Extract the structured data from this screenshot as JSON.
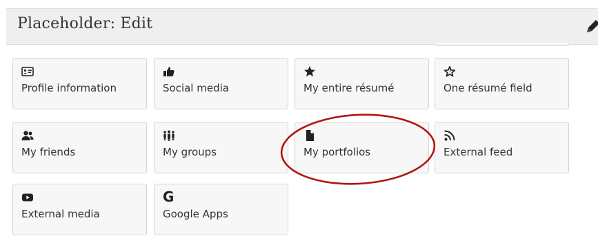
{
  "header": {
    "title": "Placeholder: Edit"
  },
  "tiles": [
    {
      "label": "Profile information",
      "icon": "id-card-icon"
    },
    {
      "label": "Social media",
      "icon": "thumbs-up-icon"
    },
    {
      "label": "My entire résumé",
      "icon": "star-icon"
    },
    {
      "label": "One résumé field",
      "icon": "star-outline-icon"
    },
    {
      "label": "My friends",
      "icon": "users-icon"
    },
    {
      "label": "My groups",
      "icon": "group-icon"
    },
    {
      "label": "My portfolios",
      "icon": "file-icon"
    },
    {
      "label": "External feed",
      "icon": "rss-icon"
    },
    {
      "label": "External media",
      "icon": "youtube-icon"
    },
    {
      "label": "Google Apps",
      "icon": "google-icon",
      "glyph": "G"
    }
  ],
  "colors": {
    "header_bg": "#efefef",
    "tile_bg": "#f7f7f7",
    "tile_border": "#d6d6d6",
    "text": "#333333",
    "annotation": "#b01515"
  }
}
